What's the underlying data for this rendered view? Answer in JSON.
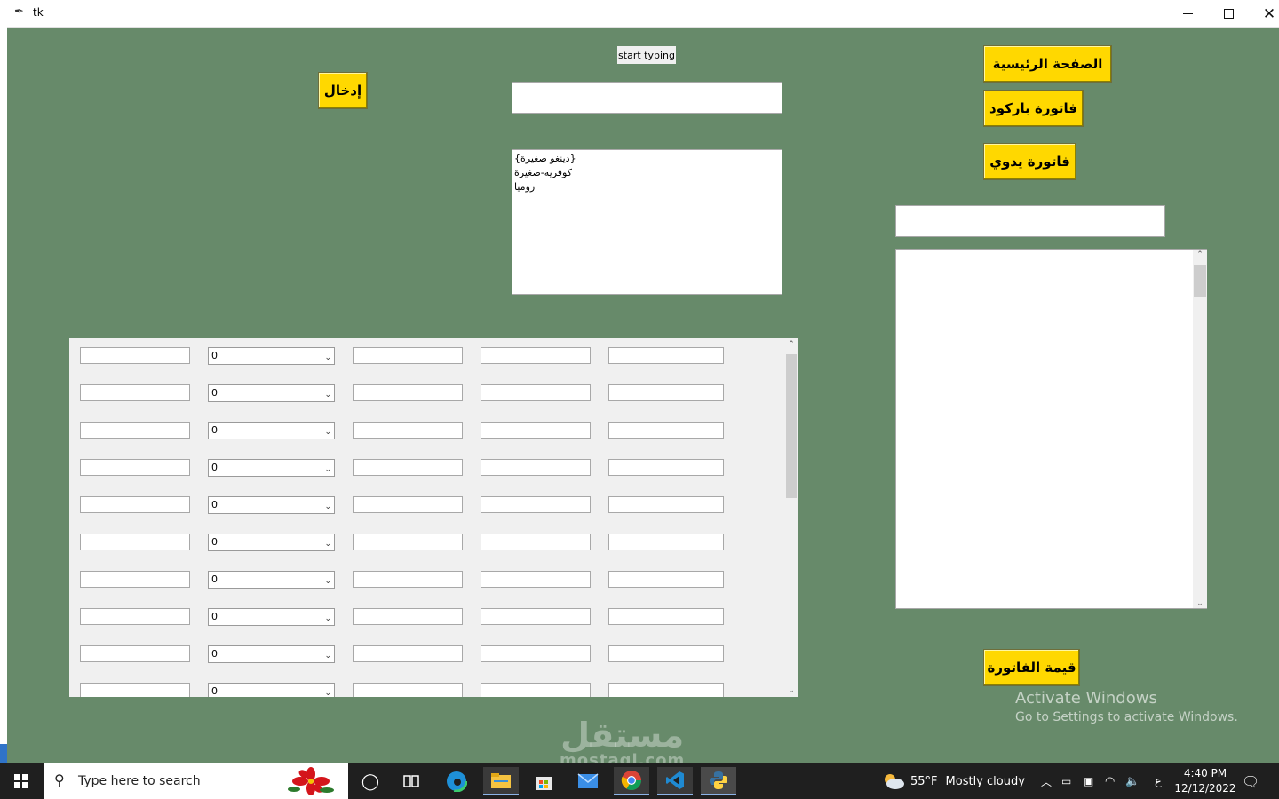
{
  "window": {
    "title": "tk"
  },
  "buttons": {
    "home": "الصفحة الرئيسية",
    "barcode_invoice": "فاتورة باركود",
    "manual_invoice": "فاتورة يدوي",
    "insert": "إدخال",
    "invoice_value": "قيمة الفاتورة"
  },
  "search": {
    "label": "start typing",
    "value": ""
  },
  "suggestions": [
    "{دينغو صغيرة}",
    "كوفريه-صغيرة",
    "روميا"
  ],
  "grid": {
    "rows": [
      {
        "qty": "0"
      },
      {
        "qty": "0"
      },
      {
        "qty": "0"
      },
      {
        "qty": "0"
      },
      {
        "qty": "0"
      },
      {
        "qty": "0"
      },
      {
        "qty": "0"
      },
      {
        "qty": "0"
      },
      {
        "qty": "0"
      },
      {
        "qty": "0"
      }
    ]
  },
  "activation": {
    "line1": "Activate Windows",
    "line2": "Go to Settings to activate Windows."
  },
  "watermark": {
    "arabic": "مستقل",
    "latin": "mostaql.com"
  },
  "taskbar": {
    "search_placeholder": "Type here to search",
    "weather_temp": "55°F",
    "weather_text": "Mostly cloudy",
    "lang": "ع",
    "time": "4:40 PM",
    "date": "12/12/2022"
  },
  "colors": {
    "client_bg": "#678a6a",
    "button_bg": "#ffd800",
    "taskbar_bg": "#1f1f1f"
  }
}
